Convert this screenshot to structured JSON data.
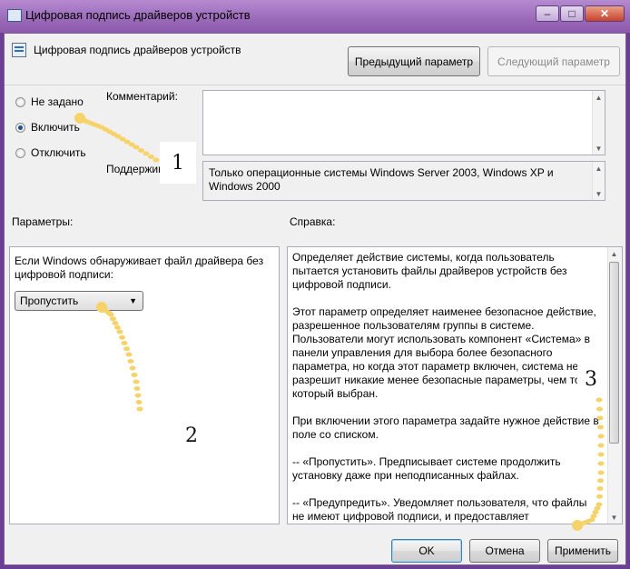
{
  "window": {
    "title": "Цифровая подпись драйверов устройств",
    "minimize_label": "–",
    "maximize_label": "□",
    "close_label": "✕"
  },
  "header": {
    "policy_title": "Цифровая подпись драйверов устройств",
    "prev_button": "Предыдущий параметр",
    "next_button": "Следующий параметр"
  },
  "state": {
    "options": [
      "Не задано",
      "Включить",
      "Отключить"
    ],
    "selected": "Включить"
  },
  "comment": {
    "label": "Комментарий:",
    "value": ""
  },
  "supported": {
    "label": "Поддерживается:",
    "value": "Только операционные системы Windows Server 2003, Windows XP и Windows 2000"
  },
  "params": {
    "heading": "Параметры:",
    "description": "Если Windows обнаруживает файл драйвера без цифровой подписи:",
    "dropdown_value": "Пропустить"
  },
  "help": {
    "heading": "Справка:",
    "paragraphs": [
      "Определяет действие системы, когда пользователь пытается установить файлы драйверов устройств без цифровой подписи.",
      "Этот параметр определяет наименее безопасное действие, разрешенное пользователям группы в системе. Пользователи могут использовать компонент «Система» в панели управления для выбора более безопасного параметра, но когда этот параметр включен, система не разрешит никакие менее безопасные параметры, чем тот, который выбран.",
      "При включении этого параметра задайте нужное действие в поле со списком.",
      "--    «Пропустить». Предписывает системе продолжить установку даже при неподписанных файлах.",
      "--    «Предупредить». Уведомляет пользователя, что файлы не имеют цифровой подписи, и предоставляет пользователю"
    ]
  },
  "footer": {
    "ok": "OK",
    "cancel": "Отмена",
    "apply": "Применить"
  },
  "annotations": {
    "marker1": "1",
    "marker2": "2",
    "marker3": "3",
    "dot_color": "#f5d36a"
  }
}
